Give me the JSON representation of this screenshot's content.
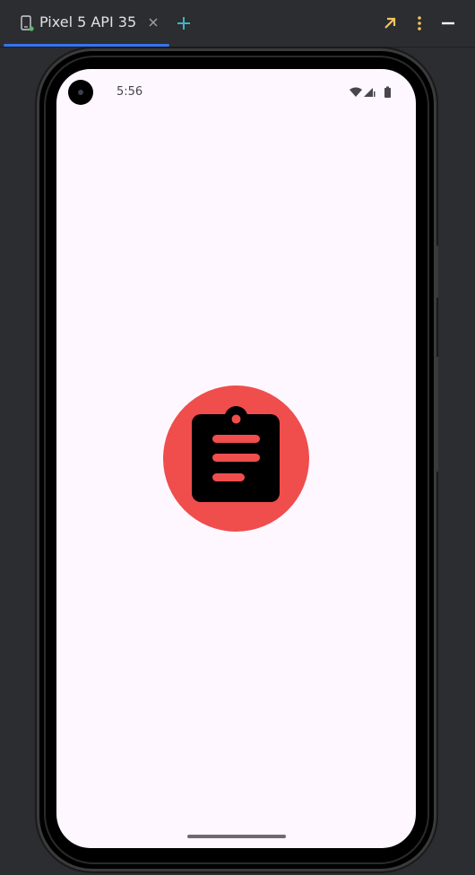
{
  "tab": {
    "label": "Pixel 5 API 35",
    "icon": "device-icon",
    "close_icon": "close-icon"
  },
  "toolbar": {
    "add_icon": "plus-icon",
    "expand_icon": "expand-arrow-icon",
    "more_icon": "more-vertical-icon",
    "minimize_icon": "minimize-icon"
  },
  "device": {
    "status_bar": {
      "time": "5:56",
      "icons": [
        "wifi-icon",
        "signal-icon",
        "battery-icon"
      ]
    },
    "app_logo": {
      "icon": "clipboard-icon",
      "background_color": "#f04d4d"
    }
  },
  "colors": {
    "ide_background": "#2b2d30",
    "tab_accent": "#3574f0",
    "screen_background": "#fef7ff",
    "add_icon": "#3fb3c2",
    "expand_icon": "#f2c55c"
  }
}
